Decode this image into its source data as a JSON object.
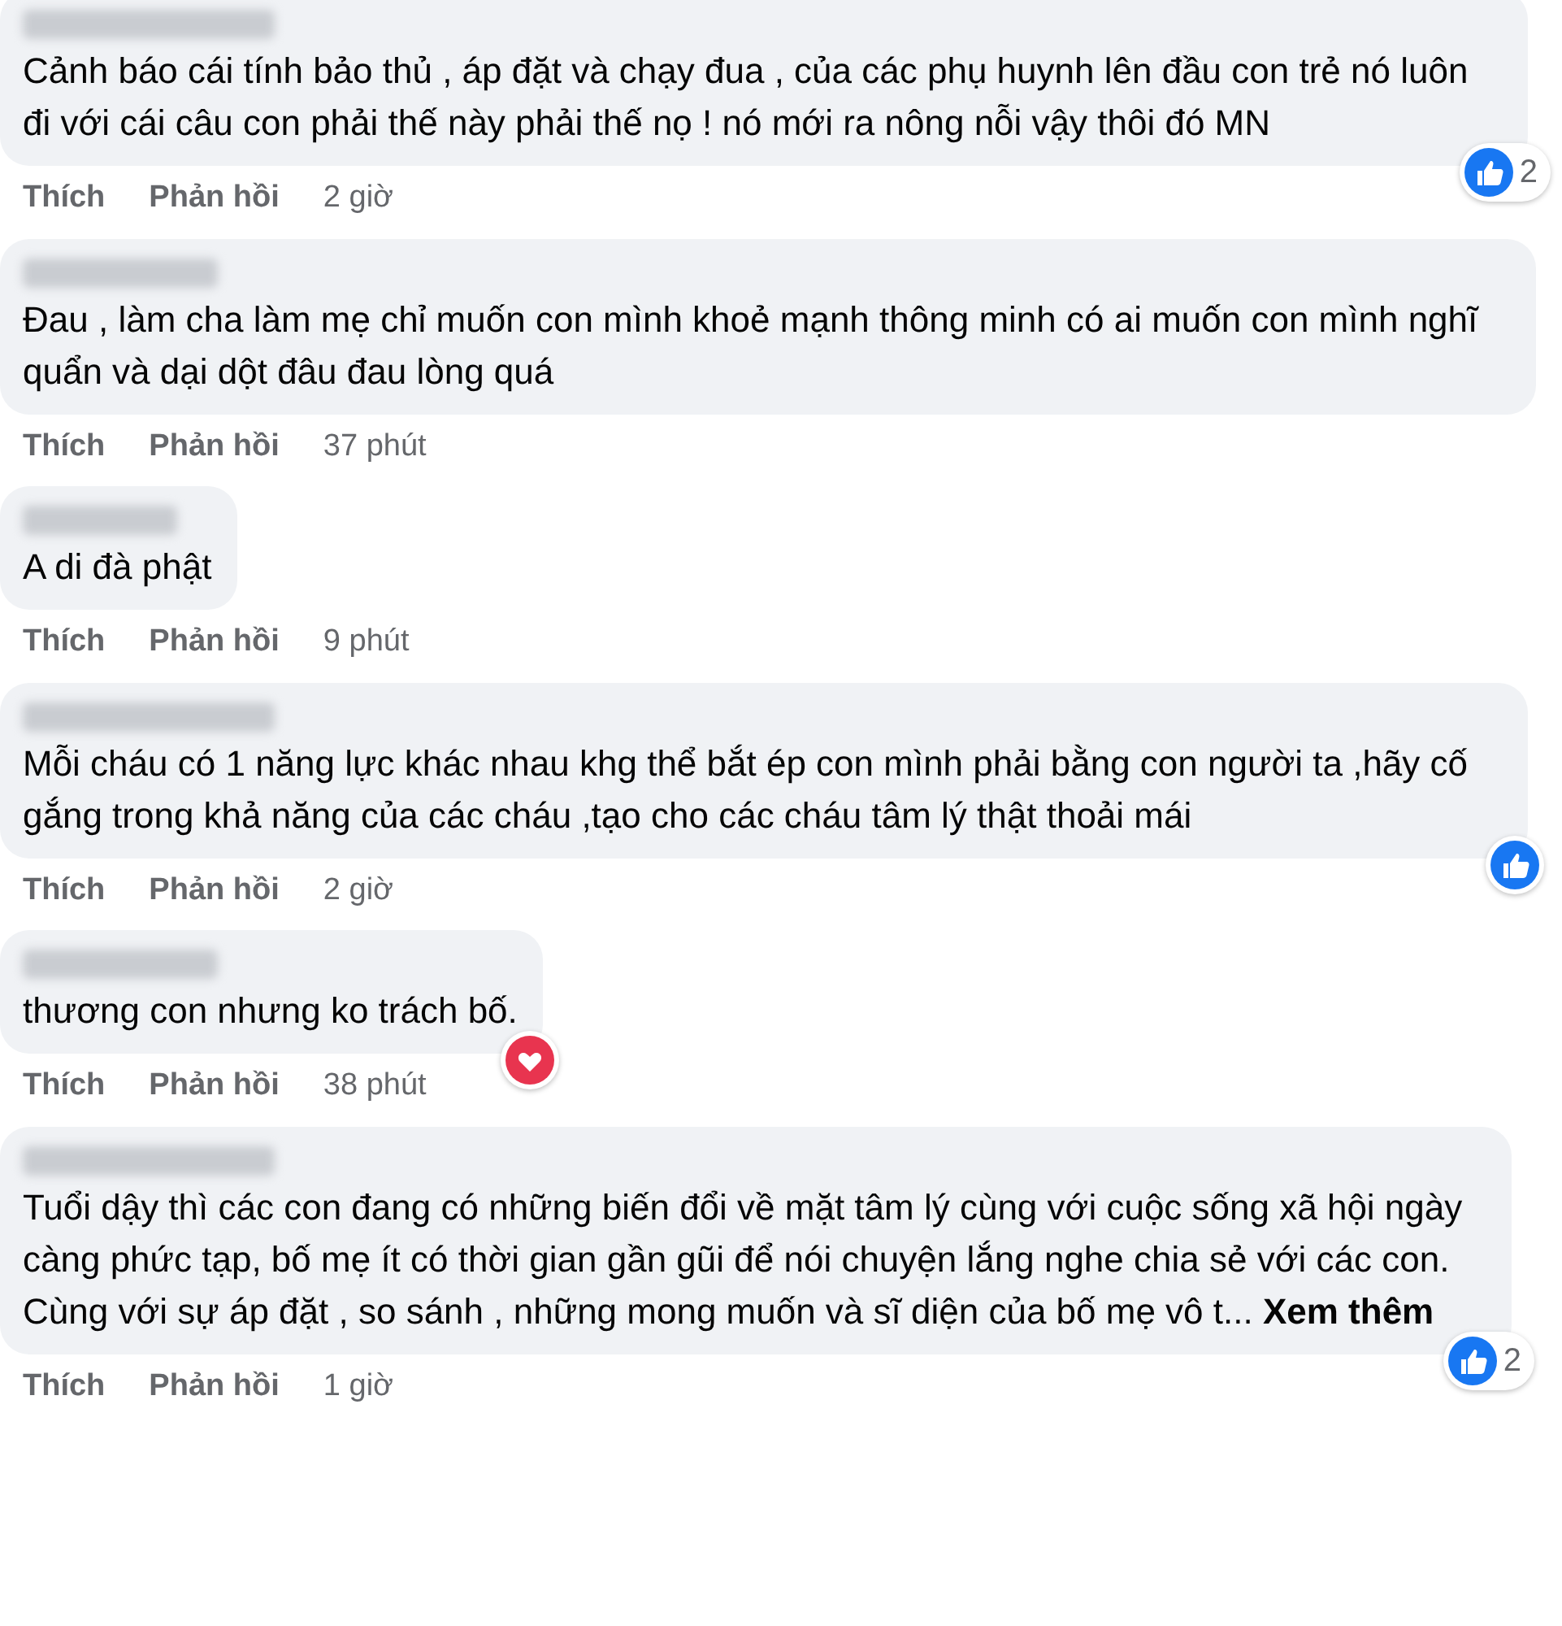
{
  "comments": [
    {
      "text": "Cảnh báo cái tính bảo thủ , áp đặt và chạy đua , của các phụ huynh lên đầu con trẻ nó luôn đi với cái câu con phải thế này phải thế nọ ! nó mới ra nông nỗi vậy thôi đó MN",
      "actions": [
        "Thích",
        "Phản hồi"
      ],
      "time": "2 giờ",
      "reaction": {
        "kind": "like",
        "count": "2"
      }
    },
    {
      "text": "Đau , làm cha làm mẹ chỉ muốn con mình khoẻ mạnh thông minh có ai muốn con mình nghĩ quẩn và dại dột đâu đau lòng quá",
      "actions": [
        "Thích",
        "Phản hồi"
      ],
      "time": "37 phút"
    },
    {
      "text": "A di đà phật",
      "actions": [
        "Thích",
        "Phản hồi"
      ],
      "time": "9 phút"
    },
    {
      "text": "Mỗi cháu có 1 năng lực khác nhau khg thể bắt ép con mình phải bằng con người ta ,hãy cố gắng trong khả năng của các cháu ,tạo cho các cháu tâm lý thật thoải mái",
      "actions": [
        "Thích",
        "Phản hồi"
      ],
      "time": "2 giờ",
      "reaction": {
        "kind": "like"
      }
    },
    {
      "text": "thương con nhưng ko trách bố.",
      "actions": [
        "Thích",
        "Phản hồi"
      ],
      "time": "38 phút",
      "reaction": {
        "kind": "love"
      }
    },
    {
      "text": "Tuổi dậy thì các con đang có những biến đổi về mặt tâm lý cùng với cuộc sống xã hội ngày càng phức tạp, bố mẹ ít có thời gian gần gũi để nói chuyện lắng nghe chia sẻ với các con. Cùng với sự áp đặt , so sánh , những mong muốn và sĩ diện của bố mẹ vô t... **Xem thêm**",
      "actions": [
        "Thích",
        "Phản hồi"
      ],
      "time": "1 giờ",
      "reaction": {
        "kind": "like",
        "count": "2"
      }
    }
  ]
}
